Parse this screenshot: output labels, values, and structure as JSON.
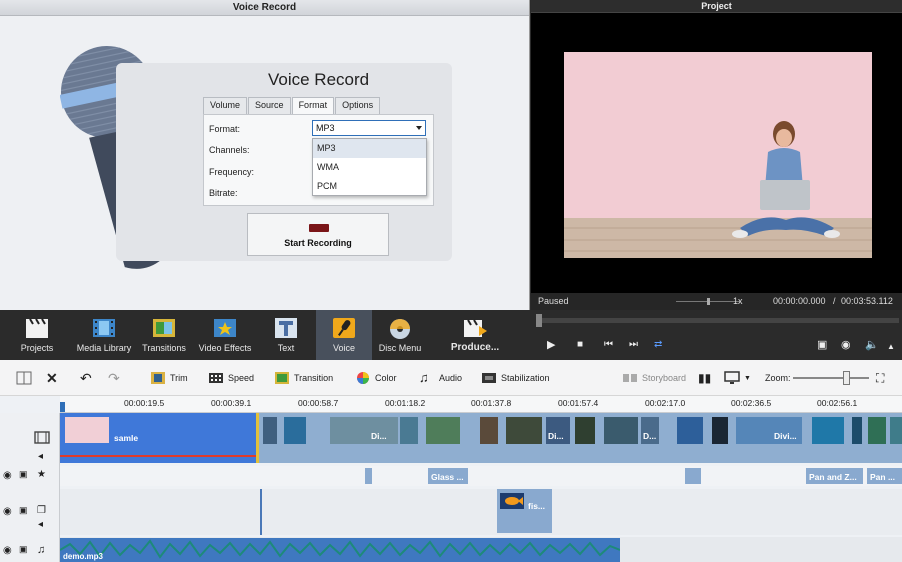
{
  "voice_panel": {
    "title": "Voice Record",
    "heading": "Voice Record",
    "tabs": [
      "Volume",
      "Source",
      "Format",
      "Options"
    ],
    "active_tab": "Format",
    "fields": {
      "format_label": "Format:",
      "channels_label": "Channels:",
      "frequency_label": "Frequency:",
      "bitrate_label": "Bitrate:"
    },
    "format_value": "MP3",
    "format_options": [
      "MP3",
      "WMA",
      "PCM"
    ],
    "start_button": "Start Recording"
  },
  "project_panel": {
    "title": "Project",
    "status": "Paused",
    "speed": "1x",
    "time_current": "00:00:00.000",
    "time_separator": "/",
    "time_total": "00:03:53.112"
  },
  "main_toolbar": {
    "items": [
      {
        "label": "Projects",
        "icon": "clapperboard-icon"
      },
      {
        "label": "Media Library",
        "icon": "film-strip-icon"
      },
      {
        "label": "Transitions",
        "icon": "transitions-icon"
      },
      {
        "label": "Video Effects",
        "icon": "star-film-icon"
      },
      {
        "label": "Text",
        "icon": "text-t-icon"
      },
      {
        "label": "Voice",
        "icon": "microphone-icon"
      },
      {
        "label": "Disc Menu",
        "icon": "disc-icon"
      },
      {
        "label": "Produce...",
        "icon": "produce-clapper-icon"
      }
    ],
    "active": "Voice"
  },
  "edit_toolbar": {
    "trim": "Trim",
    "speed": "Speed",
    "transition": "Transition",
    "color": "Color",
    "audio": "Audio",
    "stabilization": "Stabilization",
    "storyboard": "Storyboard",
    "zoom_label": "Zoom:"
  },
  "timeline": {
    "ticks": [
      "00:00:19.5",
      "00:00:39.1",
      "00:00:58.7",
      "00:01:18.2",
      "00:01:37.8",
      "00:01:57.4",
      "00:02:17.0",
      "00:02:36.5",
      "00:02:56.1"
    ],
    "video_clip_label": "samle",
    "clip_labels_short": [
      "Di...",
      "Di...",
      "D...",
      "Divi..."
    ],
    "effect_labels": [
      "Glass ...",
      "Pan and Z...",
      "Pan ..."
    ],
    "overlay_label": "fis...",
    "audio_label": "demo.mp3"
  },
  "colors": {
    "accent": "#2f6fb8",
    "selected_clip": "#3f78d9",
    "toolbar_bg": "#2b2b2b",
    "record_dot": "#7a1518"
  }
}
